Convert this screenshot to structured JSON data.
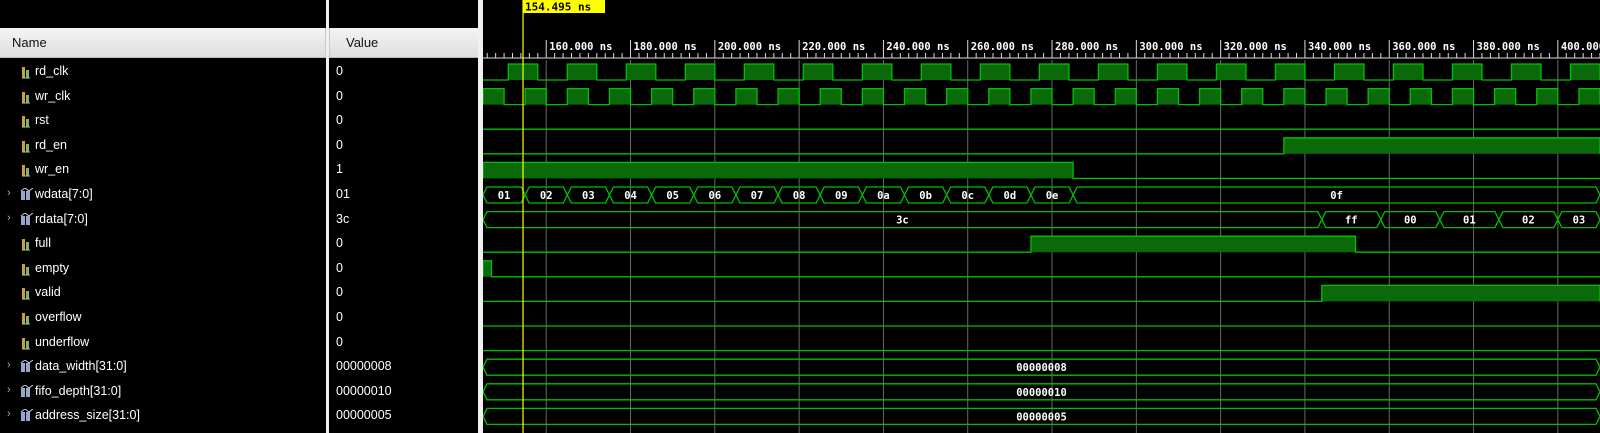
{
  "headers": {
    "name": "Name",
    "value": "Value"
  },
  "cursor": {
    "time": 154.495,
    "label": "154.495 ns"
  },
  "timeline": {
    "tick_labels": [
      "160.000 ns",
      "180.000 ns",
      "200.000 ns",
      "220.000 ns",
      "240.000 ns",
      "260.000 ns",
      "280.000 ns",
      "300.000 ns",
      "320.000 ns",
      "340.000 ns",
      "360.000 ns",
      "380.000 ns",
      "400.000 ns"
    ],
    "tick_times": [
      160,
      180,
      200,
      220,
      240,
      260,
      280,
      300,
      320,
      340,
      360,
      380,
      400
    ]
  },
  "colors": {
    "wave": "#00c000",
    "wave_fill": "#0a6a0a",
    "grid": "#6a6a6a",
    "cursor": "#ffff00"
  },
  "signals": [
    {
      "name": "rd_clk",
      "value": "0",
      "type": "clock",
      "expandable": false,
      "icon": "bit-signal-icon",
      "period": 14,
      "phase": 151
    },
    {
      "name": "wr_clk",
      "value": "0",
      "type": "clock",
      "expandable": false,
      "icon": "bit-signal-icon",
      "period": 10,
      "phase": 145
    },
    {
      "name": "rst",
      "value": "0",
      "type": "bit",
      "expandable": false,
      "icon": "bit-signal-icon",
      "high": []
    },
    {
      "name": "rd_en",
      "value": "0",
      "type": "bit",
      "expandable": false,
      "icon": "bit-signal-icon",
      "high": [
        [
          335,
          410
        ]
      ]
    },
    {
      "name": "wr_en",
      "value": "1",
      "type": "bit",
      "expandable": false,
      "icon": "bit-signal-icon",
      "high": [
        [
          145,
          285
        ]
      ]
    },
    {
      "name": "wdata[7:0]",
      "value": "01",
      "type": "bus",
      "expandable": true,
      "icon": "bus-signal-icon",
      "segments": [
        [
          "01",
          145,
          155
        ],
        [
          "02",
          155,
          165
        ],
        [
          "03",
          165,
          175
        ],
        [
          "04",
          175,
          185
        ],
        [
          "05",
          185,
          195
        ],
        [
          "06",
          195,
          205
        ],
        [
          "07",
          205,
          215
        ],
        [
          "08",
          215,
          225
        ],
        [
          "09",
          225,
          235
        ],
        [
          "0a",
          235,
          245
        ],
        [
          "0b",
          245,
          255
        ],
        [
          "0c",
          255,
          265
        ],
        [
          "0d",
          265,
          275
        ],
        [
          "0e",
          275,
          285
        ],
        [
          "0f",
          285,
          410
        ]
      ]
    },
    {
      "name": "rdata[7:0]",
      "value": "3c",
      "type": "bus",
      "expandable": true,
      "icon": "bus-signal-icon",
      "segments": [
        [
          "3c",
          145,
          344
        ],
        [
          "ff",
          344,
          358
        ],
        [
          "00",
          358,
          372
        ],
        [
          "01",
          372,
          386
        ],
        [
          "02",
          386,
          400
        ],
        [
          "03",
          400,
          410
        ]
      ]
    },
    {
      "name": "full",
      "value": "0",
      "type": "bit",
      "expandable": false,
      "icon": "bit-signal-icon",
      "high": [
        [
          275,
          352
        ]
      ]
    },
    {
      "name": "empty",
      "value": "0",
      "type": "bit",
      "expandable": false,
      "icon": "bit-signal-icon",
      "high": [
        [
          145,
          147
        ]
      ]
    },
    {
      "name": "valid",
      "value": "0",
      "type": "bit",
      "expandable": false,
      "icon": "bit-signal-icon",
      "high": [
        [
          344,
          410
        ]
      ]
    },
    {
      "name": "overflow",
      "value": "0",
      "type": "bit",
      "expandable": false,
      "icon": "bit-signal-icon",
      "high": []
    },
    {
      "name": "underflow",
      "value": "0",
      "type": "bit",
      "expandable": false,
      "icon": "bit-signal-icon",
      "high": []
    },
    {
      "name": "data_width[31:0]",
      "value": "00000008",
      "type": "bus",
      "expandable": true,
      "icon": "bus-signal-icon",
      "segments": [
        [
          "00000008",
          145,
          410
        ]
      ]
    },
    {
      "name": "fifo_depth[31:0]",
      "value": "00000010",
      "type": "bus",
      "expandable": true,
      "icon": "bus-signal-icon",
      "segments": [
        [
          "00000010",
          145,
          410
        ]
      ]
    },
    {
      "name": "address_size[31:0]",
      "value": "00000005",
      "type": "bus",
      "expandable": true,
      "icon": "bus-signal-icon",
      "segments": [
        [
          "00000005",
          145,
          410
        ]
      ]
    }
  ]
}
